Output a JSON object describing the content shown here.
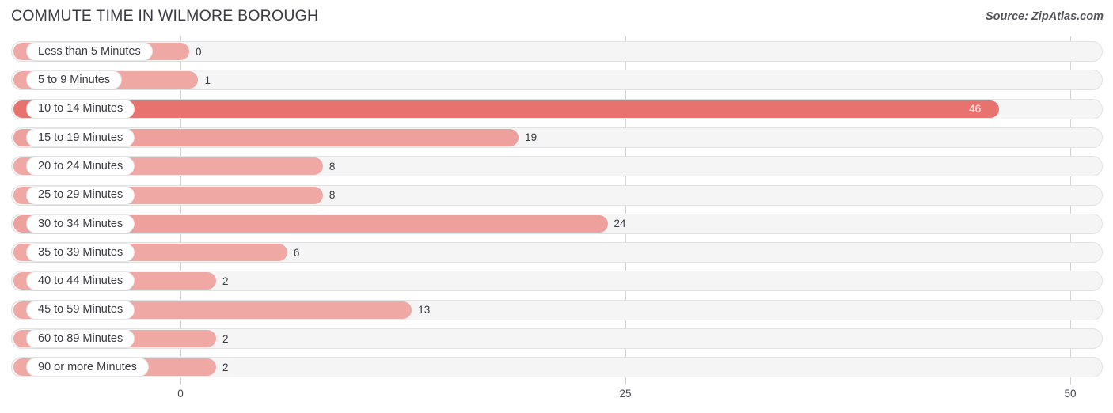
{
  "header": {
    "title": "COMMUTE TIME IN WILMORE BOROUGH",
    "source": "Source: ZipAtlas.com"
  },
  "axis": {
    "ticks": [
      "0",
      "25",
      "50"
    ]
  },
  "chart_data": {
    "type": "bar",
    "orientation": "horizontal",
    "title": "COMMUTE TIME IN WILMORE BOROUGH",
    "subtitle": "Source: ZipAtlas.com",
    "xlabel": "",
    "ylabel": "",
    "xlim": [
      0,
      50
    ],
    "xticks": [
      0,
      25,
      50
    ],
    "grid": true,
    "legend": false,
    "categories": [
      "Less than 5 Minutes",
      "5 to 9 Minutes",
      "10 to 14 Minutes",
      "15 to 19 Minutes",
      "20 to 24 Minutes",
      "25 to 29 Minutes",
      "30 to 34 Minutes",
      "35 to 39 Minutes",
      "40 to 44 Minutes",
      "45 to 59 Minutes",
      "60 to 89 Minutes",
      "90 or more Minutes"
    ],
    "values": [
      0,
      1,
      46,
      19,
      8,
      8,
      24,
      6,
      2,
      13,
      2,
      2
    ],
    "value_labels": [
      "0",
      "1",
      "46",
      "19",
      "8",
      "8",
      "24",
      "6",
      "2",
      "13",
      "2",
      "2"
    ],
    "colors": {
      "bar_max": "#e8736e",
      "bar_default": "#f0a8a5",
      "track": "#f5f5f6",
      "track_border": "#e2e2e4",
      "gridline": "#d3d3d6",
      "text": "#3a3a42",
      "value_inside_text": "#ffffff"
    }
  }
}
